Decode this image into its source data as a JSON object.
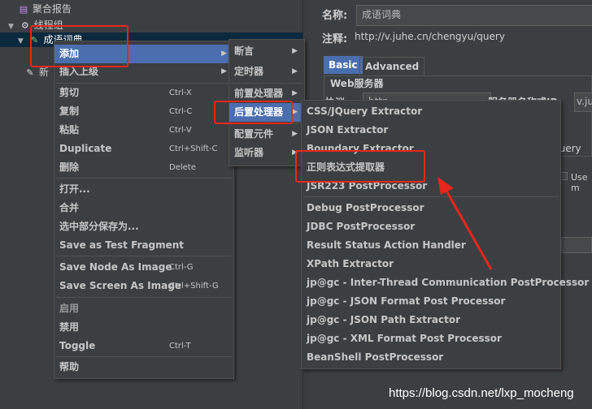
{
  "tree": {
    "row_aggregate": "聚合报告",
    "row_thread_group": "线程组",
    "row_selected": "成语词典",
    "row_new": "新"
  },
  "right_panel": {
    "name_label": "名称:",
    "name_value": "成语词典",
    "comment_label": "注释:",
    "comment_value": "http://v.juhe.cn/chengyu/query",
    "tab_basic": "Basic",
    "tab_advanced": "Advanced",
    "web_server_title": "Web服务器",
    "protocol_label": "协议:",
    "protocol_value": "http",
    "server_label": "服务器名称或IP:",
    "server_value": "v.ju",
    "path_fragment": "query",
    "use_fragment": "Use m"
  },
  "context_menu": {
    "add": "添加",
    "insert_parent": "插入上级",
    "cut": "剪切",
    "cut_sc": "Ctrl-X",
    "copy": "复制",
    "copy_sc": "Ctrl-C",
    "paste": "粘贴",
    "paste_sc": "Ctrl-V",
    "duplicate": "Duplicate",
    "duplicate_sc": "Ctrl+Shift-C",
    "delete": "删除",
    "delete_sc": "Delete",
    "open": "打开...",
    "merge": "合并",
    "save_selection": "选中部分保存为...",
    "save_fragment": "Save as Test Fragment",
    "save_node_image": "Save Node As Image",
    "save_node_image_sc": "Ctrl-G",
    "save_screen_image": "Save Screen As Image",
    "save_screen_image_sc": "Ctrl+Shift-G",
    "enable": "启用",
    "disable": "禁用",
    "toggle": "Toggle",
    "toggle_sc": "Ctrl-T",
    "help": "帮助"
  },
  "add_submenu": {
    "assertion": "断言",
    "timer": "定时器",
    "pre_processor": "前置处理器",
    "post_processor": "后置处理器",
    "config_element": "配置元件",
    "listener": "监听器"
  },
  "post_submenu": [
    "CSS/JQuery Extractor",
    "JSON Extractor",
    "Boundary Extractor",
    "正则表达式提取器",
    "JSR223 PostProcessor",
    "Debug PostProcessor",
    "JDBC PostProcessor",
    "Result Status Action Handler",
    "XPath Extractor",
    "jp@gc - Inter-Thread Communication PostProcessor",
    "jp@gc - JSON Format Post Processor",
    "jp@gc - JSON Path Extractor",
    "jp@gc - XML Format Post Processor",
    "BeanShell PostProcessor"
  ],
  "watermark": "https://blog.csdn.net/lxp_mocheng",
  "colors": {
    "accent_red": "#e8261b",
    "highlight_blue": "#4b6eaf",
    "background": "#3c3f41"
  }
}
